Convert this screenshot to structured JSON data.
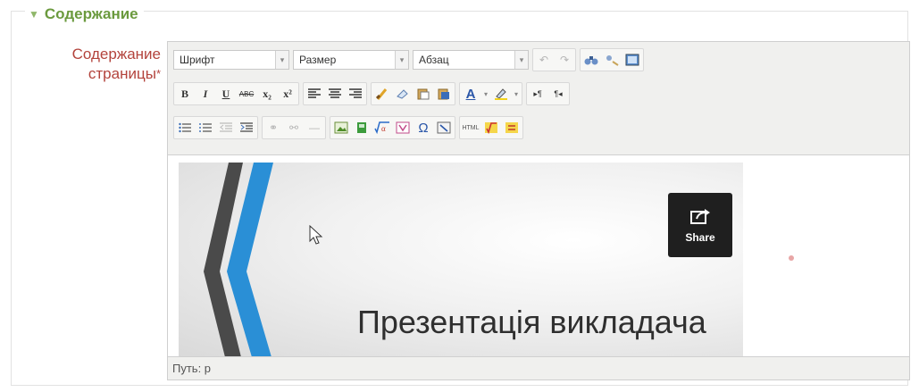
{
  "section": {
    "title": "Содержание"
  },
  "field": {
    "label_line1": "Содержание",
    "label_line2": "страницы",
    "required_mark": "*"
  },
  "toolbar": {
    "font_select": "Шрифт",
    "size_select": "Размер",
    "format_select": "Абзац",
    "bold": "B",
    "italic": "I",
    "underline": "U",
    "strike": "ABC",
    "subscript": "x₂",
    "superscript": "x²",
    "font_color": "A"
  },
  "slide": {
    "share_label": "Share",
    "title": "Презентація викладача"
  },
  "path_bar": {
    "text": "Путь: p"
  },
  "colors": {
    "legend": "#6b9a3e",
    "label": "#b3433c",
    "stripe_blue": "#2a8fd6",
    "stripe_dark": "#4a4a4a"
  }
}
